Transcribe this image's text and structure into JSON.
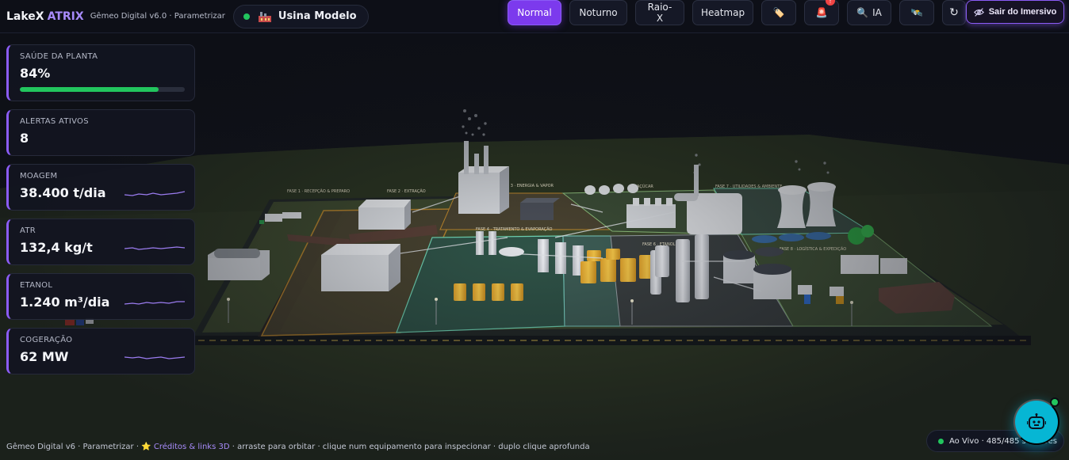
{
  "header": {
    "brand_primary": "LakeX",
    "brand_accent": "ATRIX",
    "subtitle": "Gêmeo Digital v6.0 · Parametrizar",
    "site_name": "Usina Modelo",
    "site_icon": "factory-icon",
    "buttons": {
      "normal": "Normal",
      "noturno": "Noturno",
      "raiox": "Raio-X",
      "heatmap": "Heatmap",
      "tag_icon": "🏷️",
      "alarm_icon": "🚨",
      "alarm_badge": "!",
      "ia_icon": "🔍",
      "ia_label": "IA",
      "satellite_icon": "🛰️",
      "refresh_icon": "↻"
    },
    "exit_label": "Sair do Imersivo"
  },
  "kpis": {
    "health": {
      "label": "SAÚDE DA PLANTA",
      "value": "84%",
      "progress": 0.84
    },
    "alerts": {
      "label": "ALERTAS ATIVOS",
      "value": "8"
    },
    "moagem": {
      "label": "MOAGEM",
      "value": "38.400 t/dia"
    },
    "atr": {
      "label": "ATR",
      "value": "132,4 kg/t"
    },
    "etanol": {
      "label": "ETANOL",
      "value": "1.240 m³/dia"
    },
    "cogeracao": {
      "label": "COGERAÇÃO",
      "value": "62 MW"
    }
  },
  "scene": {
    "phase_labels": {
      "p1": "FASE 1 · RECEPÇÃO & PREPARO",
      "p2": "FASE 2 · EXTRAÇÃO",
      "p3": "FASE 3 · ENERGIA & VAPOR",
      "p4": "FASE 4 · TRATAMENTO & EVAPORAÇÃO",
      "p5": "AÇÚCAR",
      "p6": "FASE 6 · ETANOL",
      "p7": "FASE 7 · UTILIDADES & AMBIENTE",
      "p8": "FASE 8 · LOGÍSTICA & EXPEDIÇÃO"
    }
  },
  "footer": {
    "text_before": "Gêmeo Digital v6 · Parametrizar · ",
    "star": "⭐",
    "link": "Créditos & links 3D",
    "text_after": " · arraste para orbitar · clique num equipamento para inspecionar · duplo clique aprofunda"
  },
  "status": {
    "label": "Ao Vivo · 485/485 sensores"
  },
  "colors": {
    "accent": "#8b5cf6",
    "live": "#22c55e",
    "alert": "#ef4444",
    "bot": "#06b6d4"
  }
}
